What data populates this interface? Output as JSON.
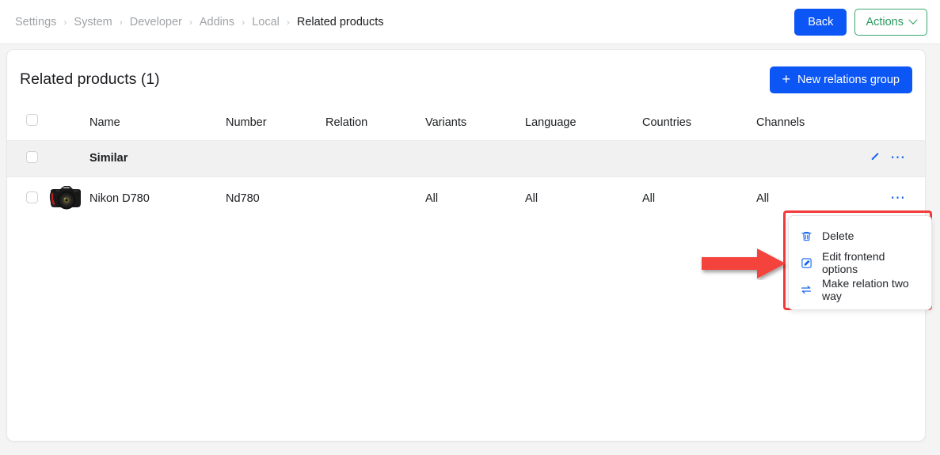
{
  "breadcrumb": {
    "items": [
      {
        "label": "Settings",
        "current": false
      },
      {
        "label": "System",
        "current": false
      },
      {
        "label": "Developer",
        "current": false
      },
      {
        "label": "Addins",
        "current": false
      },
      {
        "label": "Local",
        "current": false
      },
      {
        "label": "Related products",
        "current": true
      }
    ],
    "separator": "›"
  },
  "topbar": {
    "back_label": "Back",
    "actions_label": "Actions",
    "back_color": "#0c56f5",
    "actions_color": "#2b9a5f"
  },
  "card": {
    "title": "Related products (1)",
    "new_group_label": "New relations group",
    "new_group_plus": "+",
    "new_group_color": "#0c56f5"
  },
  "table": {
    "columns": [
      "",
      "",
      "Name",
      "Number",
      "Relation",
      "Variants",
      "Language",
      "Countries",
      "Channels",
      ""
    ],
    "headers": {
      "name": "Name",
      "number": "Number",
      "relation": "Relation",
      "variants": "Variants",
      "language": "Language",
      "countries": "Countries",
      "channels": "Channels"
    },
    "group_row": {
      "name": "Similar",
      "expand_icon": "chevron-down-icon",
      "menu_icon": "ellipsis-icon"
    },
    "rows": [
      {
        "name": "Nikon D780",
        "number": "Nd780",
        "relation": "",
        "variants": "All",
        "language": "All",
        "countries": "All",
        "channels": "All",
        "thumbnail": "camera-thumbnail",
        "menu_icon": "ellipsis-icon"
      }
    ]
  },
  "context_menu": {
    "items": [
      {
        "label": "Delete",
        "icon": "trash-icon"
      },
      {
        "label": "Edit frontend options",
        "icon": "edit-square-icon"
      },
      {
        "label": "Make relation two way",
        "icon": "two-way-arrows-icon"
      }
    ],
    "highlight_color": "#f43b3b",
    "icon_color": "#1763f2"
  },
  "annotation": {
    "arrow_color": "#f4433c",
    "arrow_direction": "right"
  }
}
